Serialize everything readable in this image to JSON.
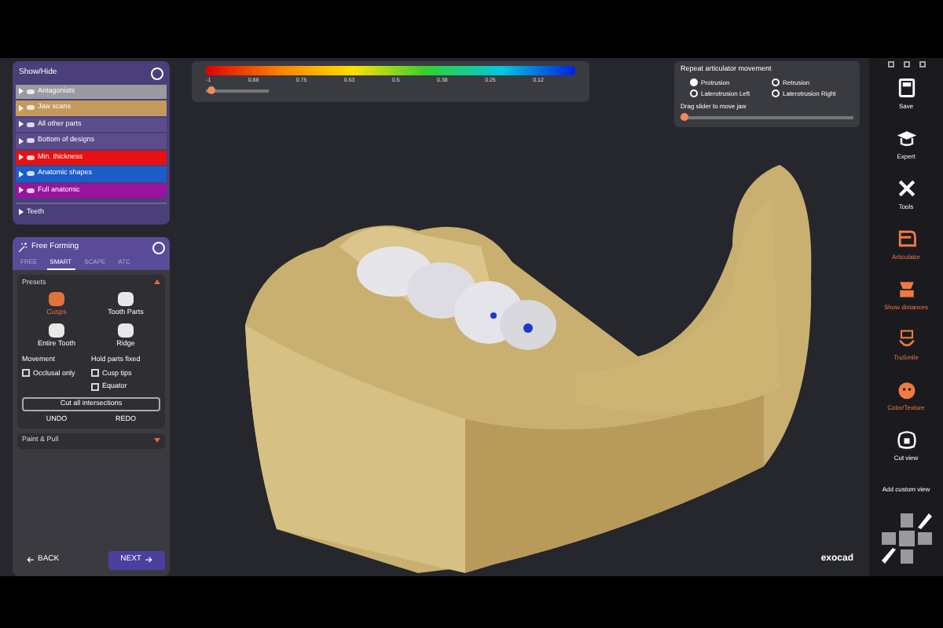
{
  "show_hide": {
    "title": "Show/Hide",
    "items": [
      {
        "label": "Antagonists",
        "color": "#9a9aa2",
        "expanded": false
      },
      {
        "label": "Jaw scans",
        "color": "#c49a5c",
        "expanded": false
      },
      {
        "label": "All other parts",
        "color": "#5c4c8c",
        "expanded": false
      },
      {
        "label": "Bottom of designs",
        "color": "#5c4c8c",
        "expanded": false
      },
      {
        "label": "Min. thickness",
        "color": "#e81010",
        "expanded": false
      },
      {
        "label": "Anatomic shapes",
        "color": "#1a5cc8",
        "expanded": false
      },
      {
        "label": "Full anatomic",
        "color": "#9a12a0",
        "expanded": false
      }
    ],
    "footer": {
      "label": "Teeth",
      "expanded": false
    }
  },
  "scale": {
    "labels": [
      "-1",
      "0.88",
      "0.75",
      "0.63",
      "0.5",
      "0.38",
      "0.25",
      "0.12"
    ],
    "level": 0.03
  },
  "free_forming": {
    "title": "Free Forming",
    "tabs": [
      {
        "label": "FREE",
        "selected": false
      },
      {
        "label": "SMART",
        "selected": true
      },
      {
        "label": "SCAPE",
        "selected": false
      },
      {
        "label": "ATC",
        "selected": false
      }
    ],
    "presets": {
      "title": "Presets",
      "expanded": true,
      "tools": [
        {
          "label": "Cusps",
          "selected": true
        },
        {
          "label": "Tooth Parts",
          "selected": false
        },
        {
          "label": "Entire Tooth",
          "selected": false
        },
        {
          "label": "Ridge",
          "selected": false
        }
      ]
    },
    "movement": {
      "title": "Movement",
      "options": [
        {
          "label": "Occlusal only",
          "checked": false
        }
      ]
    },
    "hold": {
      "title": "Hold parts fixed",
      "options": [
        {
          "label": "Cusp tips",
          "checked": false
        },
        {
          "label": "Equator",
          "checked": false
        }
      ]
    },
    "cut_button": "Cut all intersections",
    "undo": "UNDO",
    "redo": "REDO",
    "paint": {
      "title": "Paint & Pull",
      "expanded": false
    },
    "back": "BACK",
    "next": "NEXT"
  },
  "articulator": {
    "title": "Repeat articulator movement",
    "options": [
      {
        "label": "Protrusion",
        "selected": true
      },
      {
        "label": "Retrusion",
        "selected": false
      },
      {
        "label": "Laterotrusion Left",
        "selected": false
      },
      {
        "label": "Laterotrusion Right",
        "selected": false
      }
    ],
    "slider_label": "Drag slider to move jaw",
    "level": 0.0
  },
  "toolbar": {
    "items": [
      {
        "kind": "save",
        "label": "Save",
        "highlighted": false
      },
      {
        "kind": "expert",
        "label": "Expert",
        "highlighted": false
      },
      {
        "kind": "tools",
        "label": "Tools",
        "highlighted": false
      },
      {
        "kind": "articulator",
        "label": "Articulator",
        "highlighted": true
      },
      {
        "kind": "distances",
        "label": "Show distances",
        "highlighted": true
      },
      {
        "kind": "trusmile",
        "label": "TruSmile",
        "highlighted": true
      },
      {
        "kind": "texture",
        "label": "Color/Texture",
        "highlighted": true
      },
      {
        "kind": "cut",
        "label": "Cut view",
        "highlighted": false
      }
    ],
    "custom_view": "Add custom view"
  },
  "logo": "exocad"
}
